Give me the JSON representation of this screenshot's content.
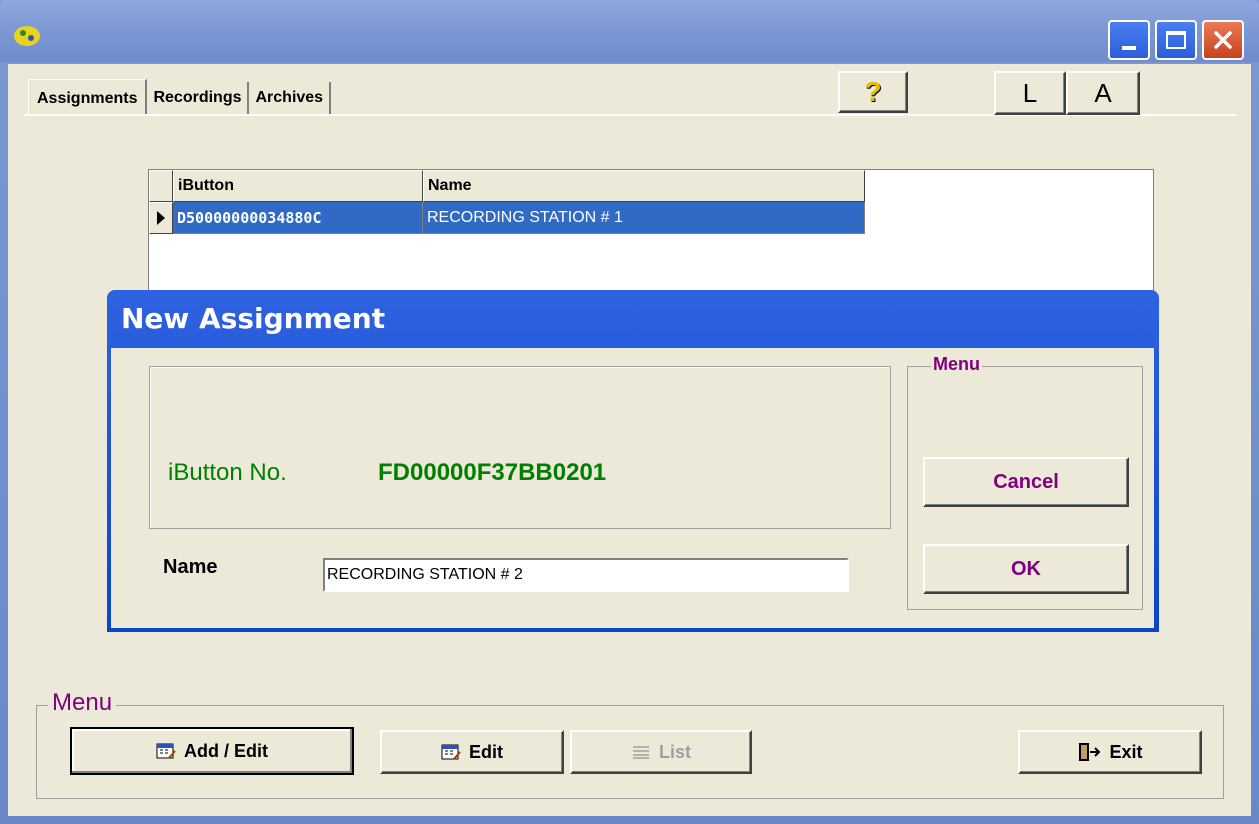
{
  "window": {
    "icon": "app-icon",
    "controls": [
      "minimize-icon",
      "maximize-icon",
      "close-icon"
    ]
  },
  "tabs": [
    {
      "label": "Assignments",
      "active": true
    },
    {
      "label": "Recordings",
      "active": false
    },
    {
      "label": "Archives",
      "active": false
    }
  ],
  "toolbar": {
    "help_icon": "question-mark-icon",
    "help_glyph": "?",
    "l_label": "L",
    "a_label": "A"
  },
  "grid": {
    "columns": [
      "iButton",
      "Name"
    ],
    "rows": [
      {
        "ibutton": "D50000000034880C",
        "name": "RECORDING STATION # 1",
        "selected": true
      }
    ]
  },
  "dialog": {
    "title": "New Assignment",
    "ibutton_label": "iButton No.",
    "ibutton_value": "FD00000F37BB0201",
    "name_label": "Name",
    "name_value": "RECORDING STATION # 2",
    "menu_label": "Menu",
    "cancel_label": "Cancel",
    "ok_label": "OK"
  },
  "menu": {
    "label": "Menu",
    "add_edit_label": "Add / Edit",
    "edit_label": "Edit",
    "list_label": "List",
    "exit_label": "Exit"
  },
  "colors": {
    "accent_purple": "#800080",
    "green": "#008000",
    "selection": "#316ac5"
  }
}
